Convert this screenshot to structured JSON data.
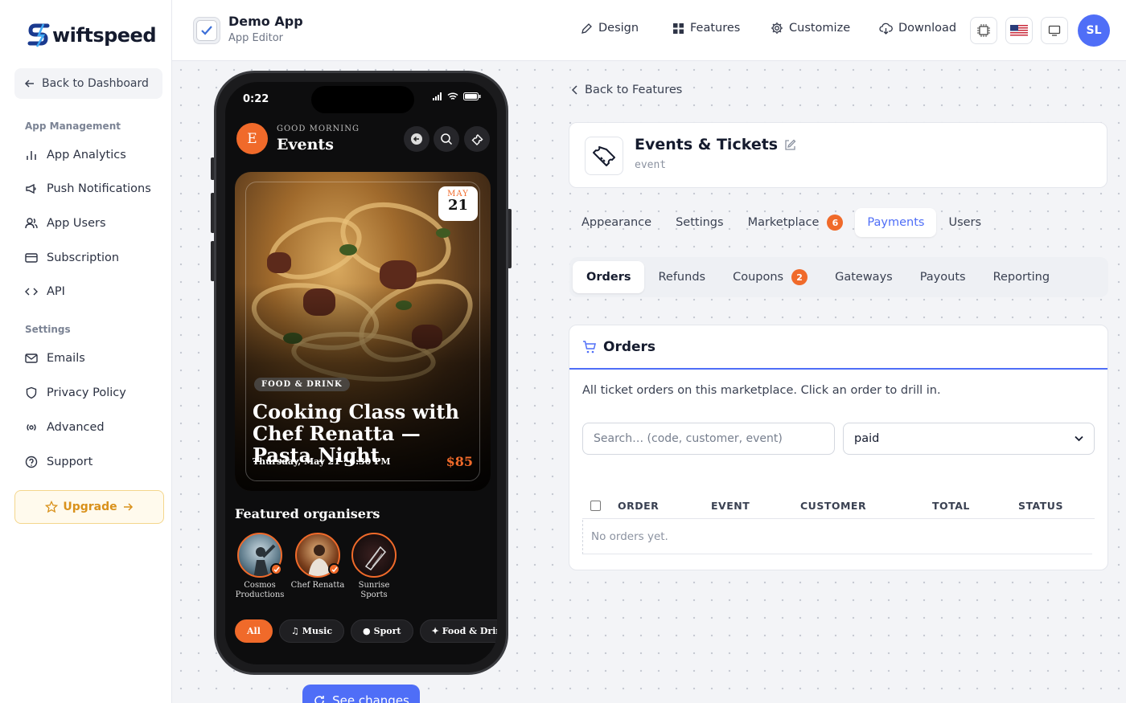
{
  "brand": {
    "name": "wiftspeed",
    "accent": "#4f6ef7",
    "orange": "#f06a2a"
  },
  "sidebar": {
    "back_label": "Back to Dashboard",
    "sections": [
      {
        "title": "App Management",
        "items": [
          {
            "label": "App Analytics",
            "icon": "bar-chart-icon"
          },
          {
            "label": "Push Notifications",
            "icon": "megaphone-icon"
          },
          {
            "label": "App Users",
            "icon": "users-icon"
          },
          {
            "label": "Subscription",
            "icon": "credit-card-icon"
          },
          {
            "label": "API",
            "icon": "code-icon"
          }
        ]
      },
      {
        "title": "Settings",
        "items": [
          {
            "label": "Emails",
            "icon": "mail-icon"
          },
          {
            "label": "Privacy Policy",
            "icon": "shield-icon"
          },
          {
            "label": "Advanced",
            "icon": "broadcast-icon"
          },
          {
            "label": "Support",
            "icon": "help-circle-icon"
          }
        ]
      }
    ],
    "upgrade_label": "Upgrade"
  },
  "topbar": {
    "app_name": "Demo App",
    "app_sub": "App Editor",
    "nav": [
      {
        "label": "Design",
        "icon": "pen-icon"
      },
      {
        "label": "Features",
        "icon": "grid-icon"
      },
      {
        "label": "Customize",
        "icon": "gear-icon"
      },
      {
        "label": "Download",
        "icon": "cloud-download-icon"
      }
    ],
    "avatar_initials": "SL"
  },
  "phone": {
    "time": "0:22",
    "avatar_letter": "E",
    "greeting": "GOOD MORNING",
    "title": "Events",
    "hero": {
      "month": "MAY",
      "day": "21",
      "category": "FOOD & DRINK",
      "title": "Cooking Class with Chef Renatta — Pasta Night",
      "when": "Thursday, May 21 · 6:30 PM",
      "price": "$85"
    },
    "featured_title": "Featured organisers",
    "organisers": [
      {
        "name": "Cosmos Productions"
      },
      {
        "name": "Chef Renatta"
      },
      {
        "name": "Sunrise Sports"
      }
    ],
    "chips": [
      "All",
      "Music",
      "Sport",
      "Food & Drink"
    ]
  },
  "see_changes_label": "See changes",
  "feature": {
    "back_label": "Back to Features",
    "name": "Events & Tickets",
    "code": "event",
    "tabs": [
      {
        "label": "Appearance",
        "badge": ""
      },
      {
        "label": "Settings",
        "badge": ""
      },
      {
        "label": "Marketplace",
        "badge": "6"
      },
      {
        "label": "Payments",
        "badge": ""
      },
      {
        "label": "Users",
        "badge": ""
      }
    ],
    "subtabs": [
      {
        "label": "Orders",
        "badge": ""
      },
      {
        "label": "Refunds",
        "badge": ""
      },
      {
        "label": "Coupons",
        "badge": "2"
      },
      {
        "label": "Gateways",
        "badge": ""
      },
      {
        "label": "Payouts",
        "badge": ""
      },
      {
        "label": "Reporting",
        "badge": ""
      }
    ]
  },
  "orders": {
    "title": "Orders",
    "description": "All ticket orders on this marketplace. Click an order to drill in.",
    "search_placeholder": "Search… (code, customer, event)",
    "status_filter": "paid",
    "columns": [
      "ORDER",
      "EVENT",
      "CUSTOMER",
      "TOTAL",
      "STATUS"
    ],
    "empty_text": "No orders yet."
  }
}
